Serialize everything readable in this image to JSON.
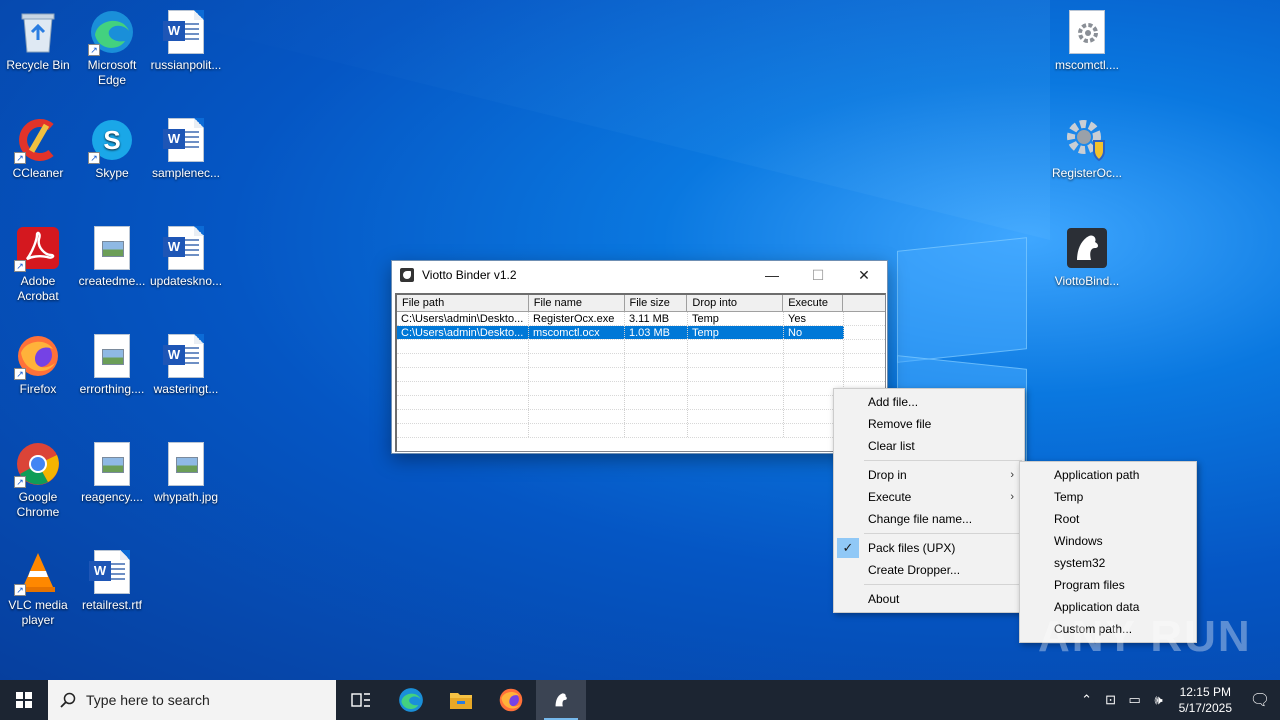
{
  "desktop": {
    "left_icons": [
      {
        "label": "Recycle Bin"
      },
      {
        "label": "Microsoft Edge"
      },
      {
        "label": "russianpolit..."
      },
      {
        "label": "CCleaner"
      },
      {
        "label": "Skype"
      },
      {
        "label": "samplenec..."
      },
      {
        "label": "Adobe Acrobat"
      },
      {
        "label": "createdme..."
      },
      {
        "label": "updateskno..."
      },
      {
        "label": "Firefox"
      },
      {
        "label": "errorthing...."
      },
      {
        "label": "wasteringt..."
      },
      {
        "label": "Google Chrome"
      },
      {
        "label": "reagency...."
      },
      {
        "label": "whypath.jpg"
      },
      {
        "label": "VLC media player"
      },
      {
        "label": "retailrest.rtf"
      }
    ],
    "right_icons": [
      {
        "label": "mscomctl...."
      },
      {
        "label": "RegisterOc..."
      },
      {
        "label": "ViottoBind..."
      }
    ]
  },
  "window": {
    "title": "Viotto Binder v1.2",
    "controls": {
      "minimize": "—",
      "maximize": "☐",
      "close": "✕"
    },
    "columns": [
      "File path",
      "File name",
      "File size",
      "Drop into",
      "Execute"
    ],
    "rows": [
      {
        "path": "C:\\Users\\admin\\Deskto...",
        "name": "RegisterOcx.exe",
        "size": "3.11 MB",
        "drop": "Temp",
        "exec": "Yes"
      },
      {
        "path": "C:\\Users\\admin\\Deskto...",
        "name": "mscomctl.ocx",
        "size": "1.03 MB",
        "drop": "Temp",
        "exec": "No"
      }
    ]
  },
  "context_menu": {
    "items": {
      "add": "Add file...",
      "remove": "Remove file",
      "clear": "Clear list",
      "drop_in": "Drop in",
      "execute": "Execute",
      "change_name": "Change file name...",
      "pack": "Pack files (UPX)",
      "dropper": "Create Dropper...",
      "about": "About"
    },
    "arrow": "›",
    "check": "✓"
  },
  "submenu": {
    "items": [
      "Application path",
      "Temp",
      "Root",
      "Windows",
      "system32",
      "Program files",
      "Application data",
      "Custom path..."
    ]
  },
  "taskbar": {
    "search_placeholder": "Type here to search",
    "time": "12:15 PM",
    "date": "5/17/2025"
  },
  "watermark": "ANY RUN",
  "colors": {
    "selection": "#0078d7",
    "taskbar": "#1c2532",
    "check_bg": "#90c8f6"
  }
}
